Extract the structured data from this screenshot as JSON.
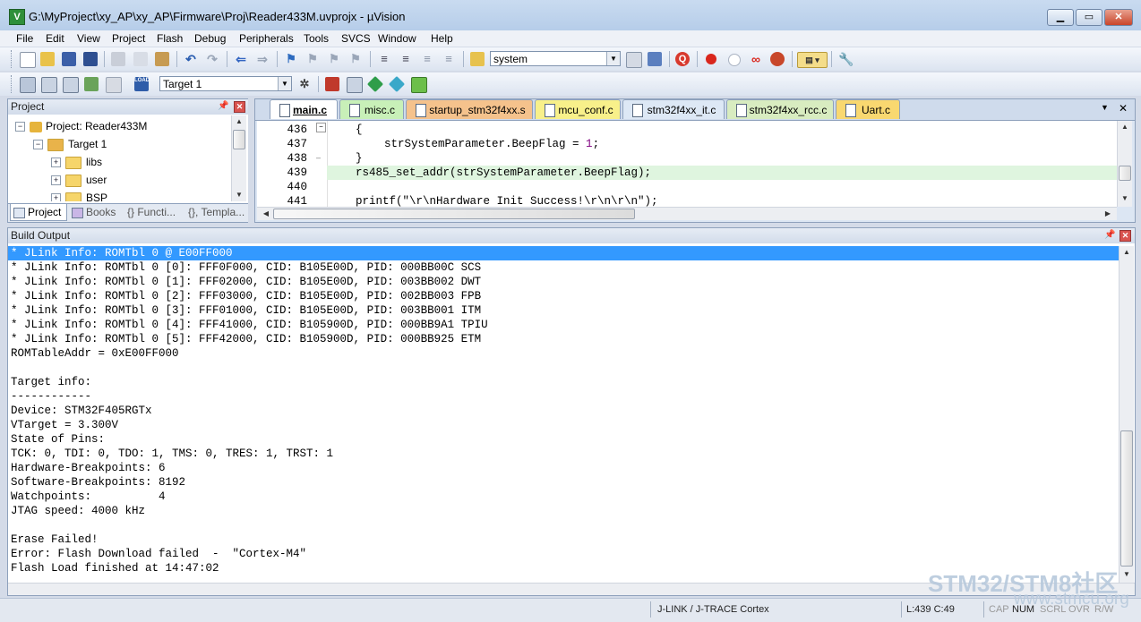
{
  "window": {
    "title": "G:\\MyProject\\xy_AP\\xy_AP\\Firmware\\Proj\\Reader433M.uvprojx - µVision",
    "min": "▁",
    "max": "▭",
    "close": "✕"
  },
  "menu": [
    "File",
    "Edit",
    "View",
    "Project",
    "Flash",
    "Debug",
    "Peripherals",
    "Tools",
    "SVCS",
    "Window",
    "Help"
  ],
  "toolbar1": {
    "search_combo": "system"
  },
  "toolbar2": {
    "target_combo": "Target 1"
  },
  "project_panel": {
    "title": "Project",
    "root": "Project: Reader433M",
    "target": "Target 1",
    "folders": [
      "libs",
      "user",
      "BSP"
    ],
    "tabs": [
      "Project",
      "Books",
      "{} Functi...",
      "{}, Templa..."
    ]
  },
  "editor": {
    "tabs": [
      {
        "label": "main.c",
        "color": "#dde8f5"
      },
      {
        "label": "misc.c",
        "color": "#c8f0b8"
      },
      {
        "label": "startup_stm32f4xx.s",
        "color": "#f5c28c"
      },
      {
        "label": "mcu_conf.c",
        "color": "#f8f08a"
      },
      {
        "label": "stm32f4xx_it.c",
        "color": "#dde8f5"
      },
      {
        "label": "stm32f4xx_rcc.c",
        "color": "#d8ecc0"
      },
      {
        "label": "Uart.c",
        "color": "#f9d870"
      }
    ],
    "menu_arrow": "▼",
    "close": "✕",
    "lines": [
      {
        "num": "436",
        "code": "{",
        "indent": 1
      },
      {
        "num": "437",
        "code": "strSystemParameter.BeepFlag = 1;",
        "indent": 2,
        "numval": "1"
      },
      {
        "num": "438",
        "code": "}",
        "indent": 1
      },
      {
        "num": "439",
        "code": "rs485_set_addr(strSystemParameter.BeepFlag);",
        "indent": 1,
        "highlight": true
      },
      {
        "num": "440",
        "code": "",
        "indent": 1
      },
      {
        "num": "441",
        "code": "printf(\"\\r\\nHardware Init Success!\\r\\n\\r\\n\");",
        "indent": 1
      }
    ]
  },
  "build_output": {
    "title": "Build Output",
    "lines": [
      "* JLink Info: ROMTbl 0 @ E00FF000",
      "* JLink Info: ROMTbl 0 [0]: FFF0F000, CID: B105E00D, PID: 000BB00C SCS",
      "* JLink Info: ROMTbl 0 [1]: FFF02000, CID: B105E00D, PID: 003BB002 DWT",
      "* JLink Info: ROMTbl 0 [2]: FFF03000, CID: B105E00D, PID: 002BB003 FPB",
      "* JLink Info: ROMTbl 0 [3]: FFF01000, CID: B105E00D, PID: 003BB001 ITM",
      "* JLink Info: ROMTbl 0 [4]: FFF41000, CID: B105900D, PID: 000BB9A1 TPIU",
      "* JLink Info: ROMTbl 0 [5]: FFF42000, CID: B105900D, PID: 000BB925 ETM",
      "ROMTableAddr = 0xE00FF000",
      "",
      "Target info:",
      "------------",
      "Device: STM32F405RGTx",
      "VTarget = 3.300V",
      "State of Pins:",
      "TCK: 0, TDI: 0, TDO: 1, TMS: 0, TRES: 1, TRST: 1",
      "Hardware-Breakpoints: 6",
      "Software-Breakpoints: 8192",
      "Watchpoints:          4",
      "JTAG speed: 4000 kHz",
      "",
      "Erase Failed!",
      "Error: Flash Download failed  -  \"Cortex-M4\"",
      "Flash Load finished at 14:47:02"
    ]
  },
  "status": {
    "debugger": "J-LINK / J-TRACE Cortex",
    "position": "L:439 C:49",
    "cap": "CAP",
    "num": "NUM",
    "scrl": "SCRL",
    "ovr": "OVR",
    "rw": "R/W"
  },
  "watermark": {
    "brand": "STM32/STM8社区",
    "url": "www.stmcu.org"
  },
  "colors": {
    "selection": "#3399ff",
    "highlight_line": "#dff5df",
    "string": "#990099",
    "number": "#800080"
  }
}
